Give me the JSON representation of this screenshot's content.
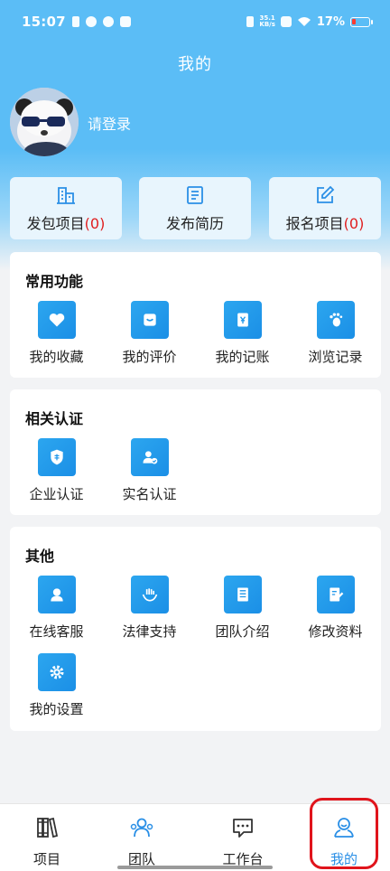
{
  "status": {
    "time": "15:07",
    "net_speed_value": "35.1",
    "net_speed_unit": "KB/s",
    "battery": "17%",
    "battery_level": 0.17
  },
  "header": {
    "title": "我的"
  },
  "profile": {
    "login_label": "请登录"
  },
  "quick_actions": [
    {
      "label": "发包项目",
      "count": "(0)",
      "icon": "building-icon"
    },
    {
      "label": "发布简历",
      "count": "",
      "icon": "resume-icon"
    },
    {
      "label": "报名项目",
      "count": "(0)",
      "icon": "edit-icon"
    }
  ],
  "sections": {
    "common": {
      "title": "常用功能",
      "items": [
        {
          "label": "我的收藏",
          "icon": "heart-icon"
        },
        {
          "label": "我的评价",
          "icon": "review-icon"
        },
        {
          "label": "我的记账",
          "icon": "ledger-icon"
        },
        {
          "label": "浏览记录",
          "icon": "footprint-icon"
        }
      ]
    },
    "certification": {
      "title": "相关认证",
      "items": [
        {
          "label": "企业认证",
          "icon": "enterprise-shield-icon"
        },
        {
          "label": "实名认证",
          "icon": "user-verified-icon"
        }
      ]
    },
    "other": {
      "title": "其他",
      "items": [
        {
          "label": "在线客服",
          "icon": "customer-service-icon"
        },
        {
          "label": "法律支持",
          "icon": "legal-support-icon"
        },
        {
          "label": "团队介绍",
          "icon": "team-intro-icon"
        },
        {
          "label": "修改资料",
          "icon": "edit-profile-icon"
        },
        {
          "label": "我的设置",
          "icon": "settings-gear-icon"
        }
      ]
    }
  },
  "bottom_nav": {
    "items": [
      {
        "label": "项目",
        "icon": "books-icon"
      },
      {
        "label": "团队",
        "icon": "team-icon"
      },
      {
        "label": "工作台",
        "icon": "chat-bubble-icon"
      },
      {
        "label": "我的",
        "icon": "user-smile-icon",
        "active": true
      }
    ]
  },
  "colors": {
    "accent": "#2a8fe6",
    "header_blue": "#5bbdf6",
    "count_red": "#e02020",
    "highlight_red": "#e0141c"
  }
}
